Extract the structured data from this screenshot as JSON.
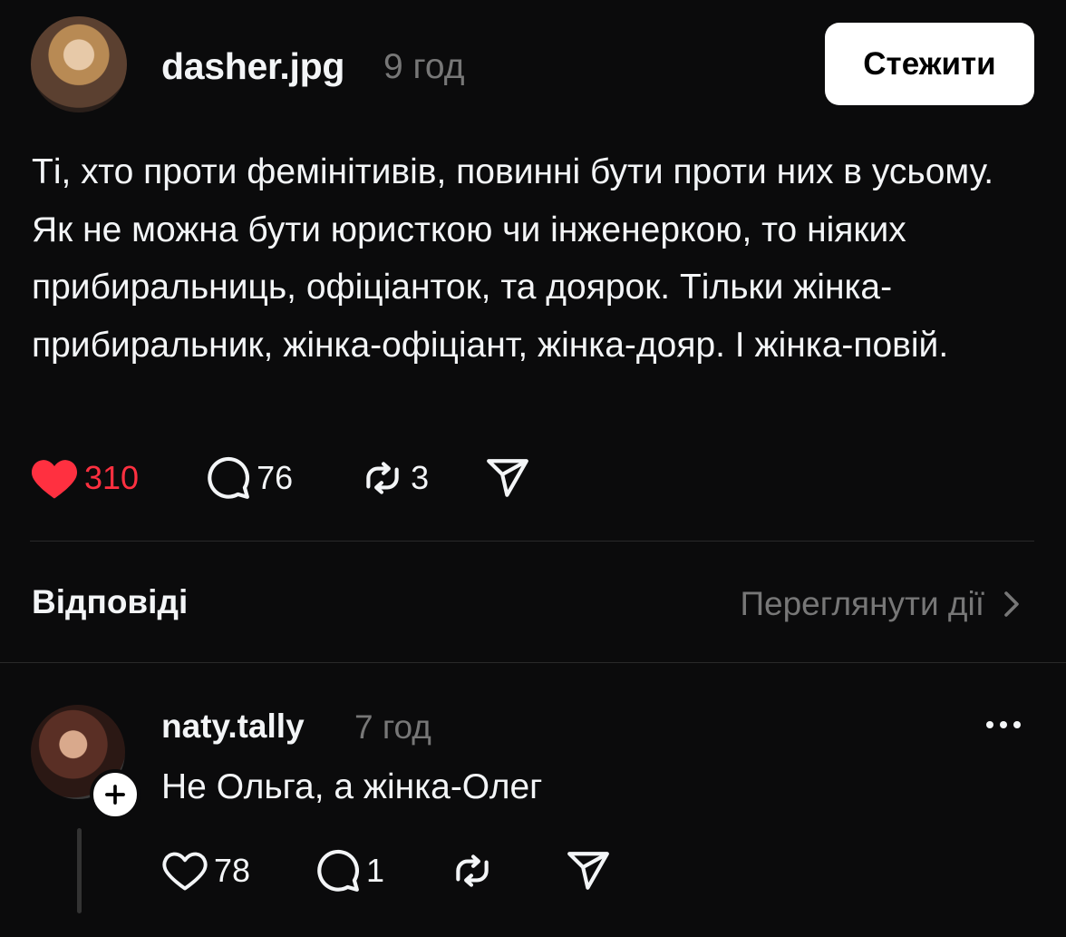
{
  "post": {
    "username": "dasher.jpg",
    "time": "9 год",
    "follow_label": "Стежити",
    "text": "Ті, хто проти фемінітивів, повинні бути проти них в усьому. Як не можна бути юристкою чи інженеркою, то ніяких прибиральниць, офіціанток, та доярок. Тільки жінка-прибиральник, жінка-офіціант, жінка-дояр. І жінка-повій.",
    "likes": "310",
    "comments": "76",
    "reposts": "3",
    "liked": true
  },
  "replies_section": {
    "heading": "Відповіді",
    "view_activity_label": "Переглянути дії"
  },
  "reply": {
    "username": "naty.tally",
    "time": "7 год",
    "text": "Не Ольга, а жінка-Олег",
    "likes": "78",
    "comments": "1"
  },
  "colors": {
    "background": "#0b0b0c",
    "text": "#f3f5f7",
    "muted": "#777777",
    "like_red": "#ff3040",
    "divider": "#2a2a2a"
  },
  "icons": [
    "heart-filled-icon",
    "comment-icon",
    "repost-icon",
    "share-icon",
    "heart-outline-icon",
    "more-icon",
    "plus-icon",
    "chevron-right-icon"
  ]
}
